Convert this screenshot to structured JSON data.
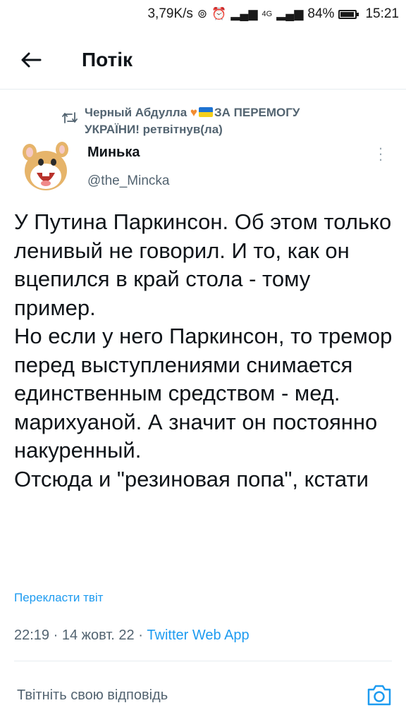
{
  "status_bar": {
    "network_speed": "3,79K/s",
    "network_type": "4G",
    "battery_level": "84%",
    "time": "15:21"
  },
  "header": {
    "title": "Потік"
  },
  "tweet": {
    "retweeter_name": "Черный Абдулла",
    "retweeter_rest_1": "ЗА ПЕРЕМОГУ",
    "retweeter_rest_2": "УКРАЇНИ!",
    "retweet_suffix": "ретвітнув(ла)",
    "author_name": "Минька",
    "author_handle": "@the_Mincka",
    "text": "У Путина Паркинсон. Об этом только ленивый не говорил. И то, как он вцепился в край стола - тому пример.\nНо если у него Паркинсон, то тремор перед выступлениями снимается единственным средством - мед. марихуаной. А значит он постоянно накуренный.\nОтсюда и \"резиновая попа\", кстати",
    "translate_label": "Перекласти твіт",
    "time": "22:19",
    "date": "14 жовт. 22",
    "source_app": "Twitter Web App"
  },
  "reply": {
    "placeholder": "Твітніть свою відповідь"
  },
  "colors": {
    "accent": "#1d9bf0",
    "secondary_text": "#536471"
  }
}
